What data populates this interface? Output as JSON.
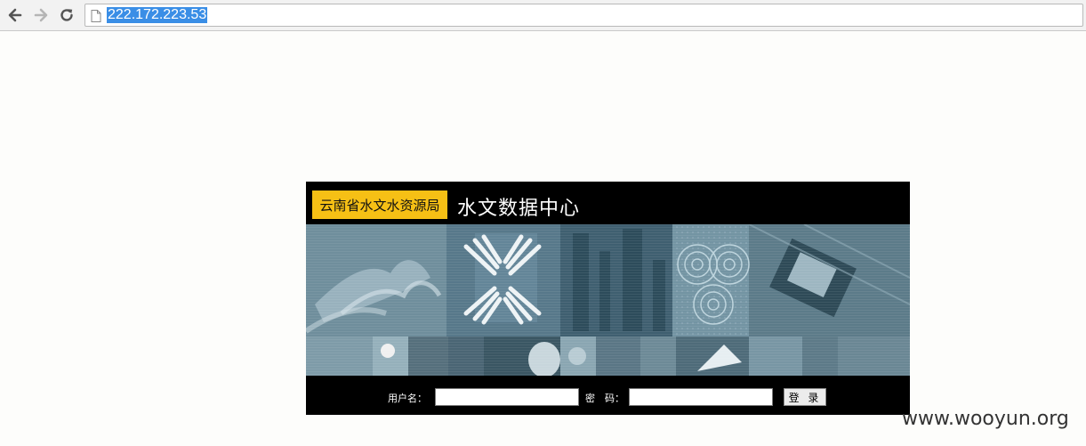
{
  "browser": {
    "url": "222.172.223.53"
  },
  "login": {
    "org_name": "云南省水文水资源局",
    "site_title": "水文数据中心",
    "username_label": "用户名：",
    "username_value": "",
    "password_label": "密　码：",
    "password_value": "",
    "submit_label": "登 录"
  },
  "watermark": "www.wooyun.org",
  "colors": {
    "org_badge": "#f6c015",
    "panel_background": "#000000",
    "banner_tint": "#5e7d8c",
    "url_highlight": "#3a8ee6"
  },
  "icons": {
    "back": "arrow-left-icon",
    "forward": "arrow-right-icon",
    "reload": "reload-icon",
    "page": "page-icon"
  }
}
